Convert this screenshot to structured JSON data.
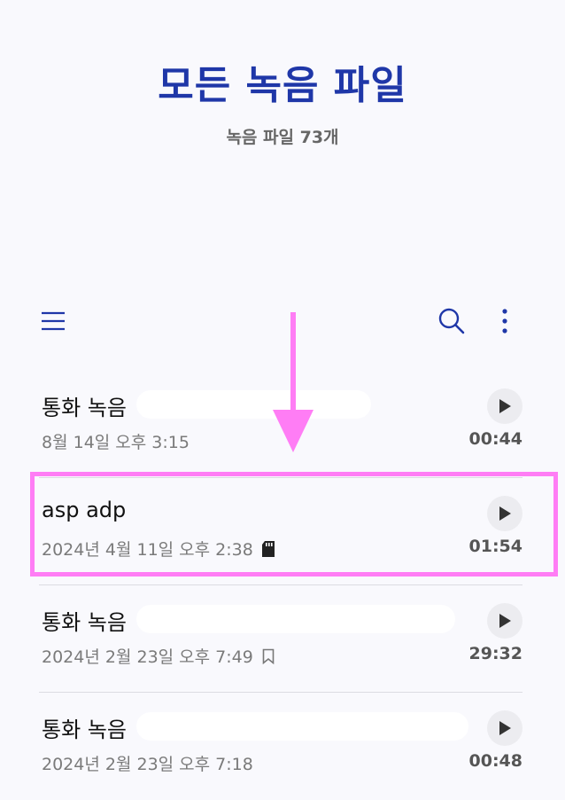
{
  "header": {
    "title": "모든 녹음 파일",
    "subtitle": "녹음 파일 73개"
  },
  "toolbar": {
    "menu_icon": "hamburger-menu-icon",
    "search_icon": "search-icon",
    "more_icon": "more-vertical-icon"
  },
  "recordings": [
    {
      "title": "통화 녹음",
      "meta": "8월 14일 오후 3:15",
      "duration": "00:44",
      "badge": ""
    },
    {
      "title": "asp adp",
      "meta": "2024년 4월 11일 오후 2:38",
      "duration": "01:54",
      "badge": "sd-card-icon"
    },
    {
      "title": "통화 녹음",
      "meta": "2024년 2월 23일 오후 7:49",
      "duration": "29:32",
      "badge": "bookmark-icon"
    },
    {
      "title": "통화 녹음",
      "meta": "2024년 2월 23일 오후 7:18",
      "duration": "00:48",
      "badge": ""
    }
  ],
  "annotation": {
    "highlight_color": "#ff7df5",
    "arrow_color": "#ff7df5"
  },
  "colors": {
    "accent": "#1f37a8",
    "subtitle": "#666666",
    "meta": "#7a7a7a"
  }
}
